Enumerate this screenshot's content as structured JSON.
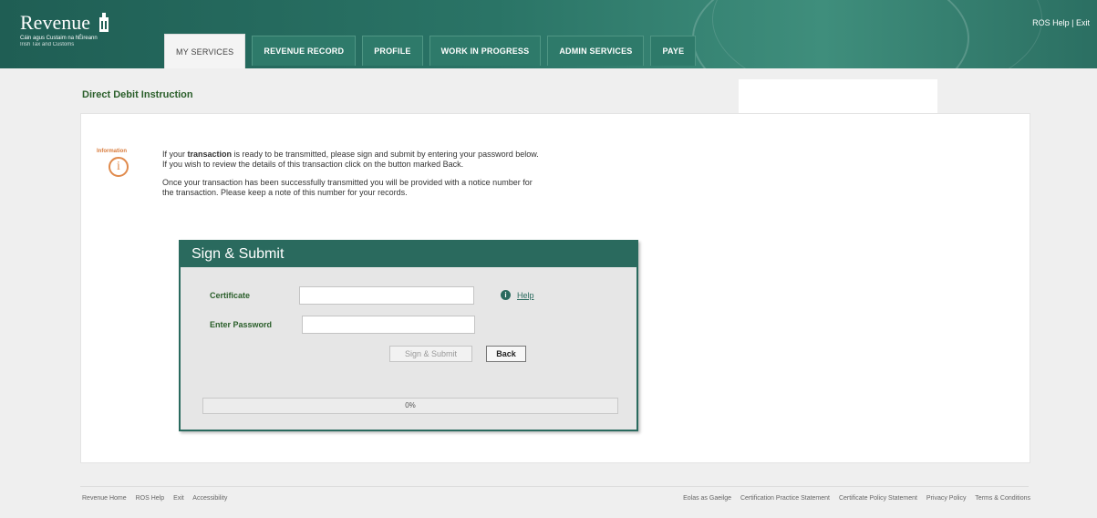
{
  "header": {
    "logo_text": "Revenue",
    "logo_subtitle_1": "Cáin agus Custaim na hÉireann",
    "logo_subtitle_2": "Irish Tax and Customs",
    "ros_help": "ROS Help",
    "separator": " | ",
    "exit": "Exit",
    "tabs": [
      {
        "label": "MY SERVICES",
        "active": true
      },
      {
        "label": "REVENUE RECORD",
        "active": false
      },
      {
        "label": "PROFILE",
        "active": false
      },
      {
        "label": "WORK IN PROGRESS",
        "active": false
      },
      {
        "label": "ADMIN SERVICES",
        "active": false
      },
      {
        "label": "PAYE",
        "active": false
      }
    ]
  },
  "page_title": "Direct Debit Instruction",
  "info": {
    "label": "Information",
    "icon": "info-icon",
    "line1_pre": "If your ",
    "line1_bold": "transaction",
    "line1_post": " is ready to be transmitted, please sign and submit by entering your password below.",
    "line2": "If you wish to review the details of this transaction click on the button marked Back.",
    "line3": "Once your transaction has been successfully transmitted you will be provided with a notice number for",
    "line4": "the transaction. Please keep a note of this number for your records."
  },
  "sign_submit": {
    "title": "Sign & Submit",
    "certificate_label": "Certificate",
    "certificate_value": "",
    "help_label": "Help",
    "password_label": "Enter Password",
    "password_value": "",
    "submit_button": "Sign & Submit",
    "back_button": "Back",
    "progress_percent": 0,
    "progress_text": "0%"
  },
  "footer": {
    "left_links": [
      "Revenue Home",
      "ROS Help",
      "Exit",
      "Accessibility"
    ],
    "right_links": [
      "Eolas as Gaeilge",
      "Certification Practice Statement",
      "Certificate Policy Statement",
      "Privacy Policy",
      "Terms & Conditions"
    ]
  },
  "colors": {
    "brand_green": "#2a6a5e",
    "info_orange": "#e08a4c"
  }
}
